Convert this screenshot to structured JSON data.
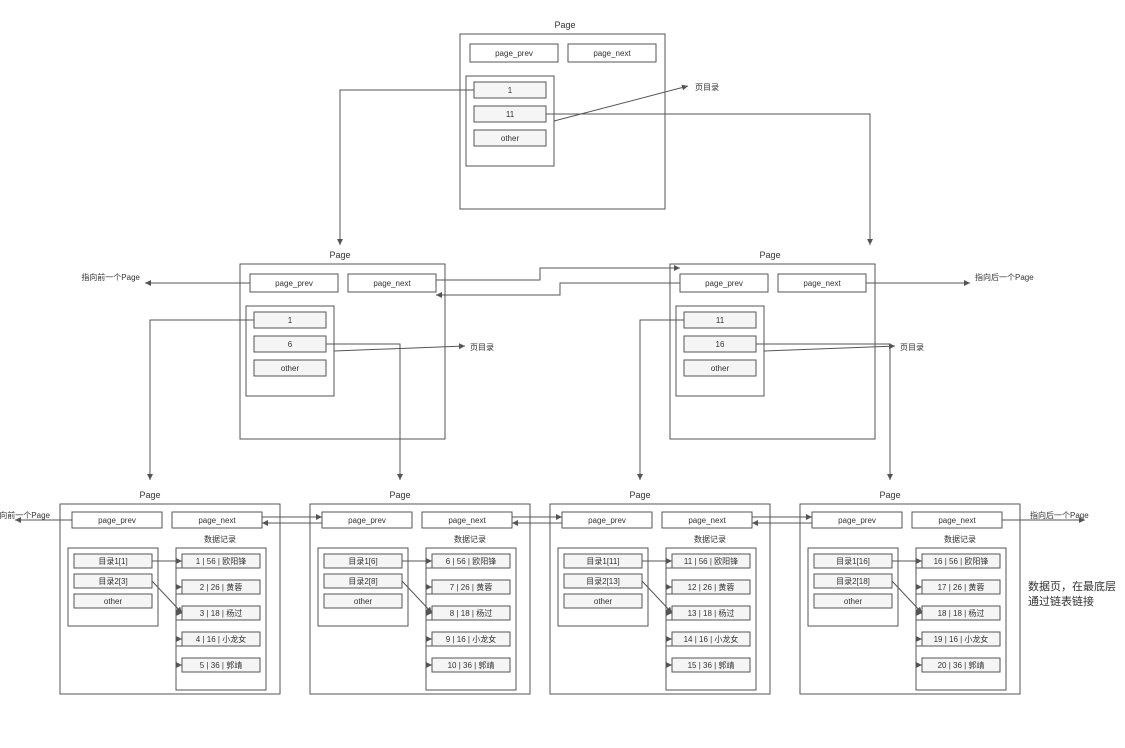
{
  "labels": {
    "Page": "Page",
    "page_prev": "page_prev",
    "page_next": "page_next",
    "other": "other",
    "dir": "页目录",
    "data_record": "数据记录",
    "prev_page": "指向前一个Page",
    "next_page": "指向后一个Page",
    "datapage_note": "数据页，在最底层通过链表链接"
  },
  "root": {
    "entries": [
      "1",
      "11",
      "other"
    ],
    "dir_label": "页目录"
  },
  "mid_left": {
    "entries": [
      "1",
      "6",
      "other"
    ],
    "dir_label": "页目录"
  },
  "mid_right": {
    "entries": [
      "11",
      "16",
      "other"
    ],
    "dir_label": "页目录"
  },
  "leaf1": {
    "dir": [
      "目录1[1]",
      "目录2[3]",
      "other"
    ],
    "rows": [
      "1 | 56 | 欧阳锋",
      "2 | 26 | 黄蓉",
      "3 | 18 | 杨过",
      "4 | 16 | 小龙女",
      "5 | 36 | 郭靖"
    ]
  },
  "leaf2": {
    "dir": [
      "目录1[6]",
      "目录2[8]",
      "other"
    ],
    "rows": [
      "6 | 56 | 欧阳锋",
      "7 | 26 | 黄蓉",
      "8 | 18 | 杨过",
      "9 | 16 | 小龙女",
      "10 | 36 | 郭靖"
    ]
  },
  "leaf3": {
    "dir": [
      "目录1[11]",
      "目录2[13]",
      "other"
    ],
    "rows": [
      "11 | 56 | 欧阳锋",
      "12 | 26 | 黄蓉",
      "13 | 18 | 杨过",
      "14 | 16 | 小龙女",
      "15 | 36 | 郭靖"
    ]
  },
  "leaf4": {
    "dir": [
      "目录1[16]",
      "目录2[18]",
      "other"
    ],
    "rows": [
      "16 | 56 | 欧阳锋",
      "17 | 26 | 黄蓉",
      "18 | 18 | 杨过",
      "19 | 16 | 小龙女",
      "20 | 36 | 郭靖"
    ]
  }
}
